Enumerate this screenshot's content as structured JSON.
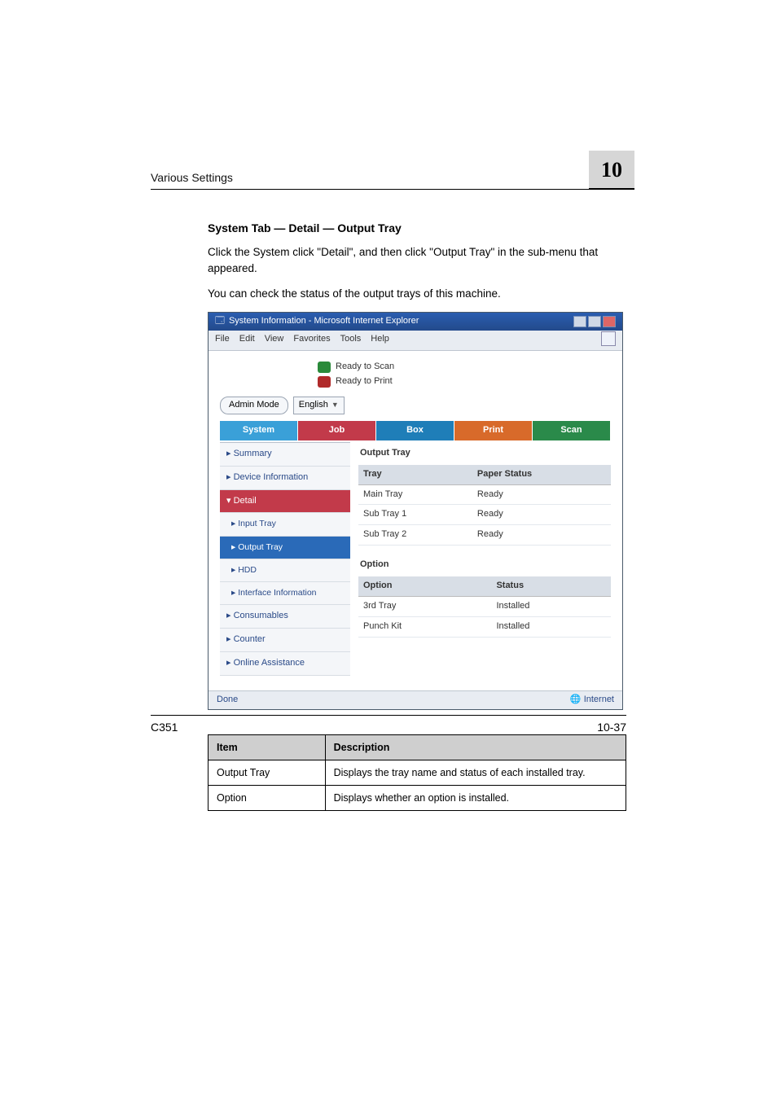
{
  "running_header": "Various Settings",
  "chapter_number": "10",
  "section_title": "System Tab — Detail — Output Tray",
  "para1": "Click the System click \"Detail\", and then click \"Output Tray\" in the sub-menu that appeared.",
  "para2": "You can check the status of the output trays of this machine.",
  "shot": {
    "window_title": "System Information - Microsoft Internet Explorer",
    "menu": {
      "file": "File",
      "edit": "Edit",
      "view": "View",
      "favorites": "Favorites",
      "tools": "Tools",
      "help": "Help"
    },
    "status1": "Ready to Scan",
    "status2": "Ready to Print",
    "admin_mode": "Admin Mode",
    "lang": "English",
    "tabs": {
      "system": "System",
      "job": "Job",
      "box": "Box",
      "print": "Print",
      "scan": "Scan"
    },
    "nav": {
      "summary": "Summary",
      "device_info": "Device Information",
      "detail": "Detail",
      "input_tray": "Input Tray",
      "output_tray": "Output Tray",
      "hdd": "HDD",
      "interface": "Interface Information",
      "consumables": "Consumables",
      "counter": "Counter",
      "online": "Online Assistance"
    },
    "panel": {
      "title1": "Output Tray",
      "th_tray": "Tray",
      "th_status": "Paper Status",
      "rows": [
        {
          "tray": "Main Tray",
          "status": "Ready"
        },
        {
          "tray": "Sub Tray 1",
          "status": "Ready"
        },
        {
          "tray": "Sub Tray 2",
          "status": "Ready"
        }
      ],
      "title2": "Option",
      "th_option": "Option",
      "th_ostatus": "Status",
      "orows": [
        {
          "opt": "3rd Tray",
          "status": "Installed"
        },
        {
          "opt": "Punch Kit",
          "status": "Installed"
        }
      ]
    },
    "status_left": "Done",
    "status_right": "Internet"
  },
  "desc": {
    "th_item": "Item",
    "th_desc": "Description",
    "rows": [
      {
        "item": "Output Tray",
        "desc": "Displays the tray name and status of each installed tray."
      },
      {
        "item": "Option",
        "desc": "Displays whether an option is installed."
      }
    ]
  },
  "footer_left": "C351",
  "footer_right": "10-37"
}
